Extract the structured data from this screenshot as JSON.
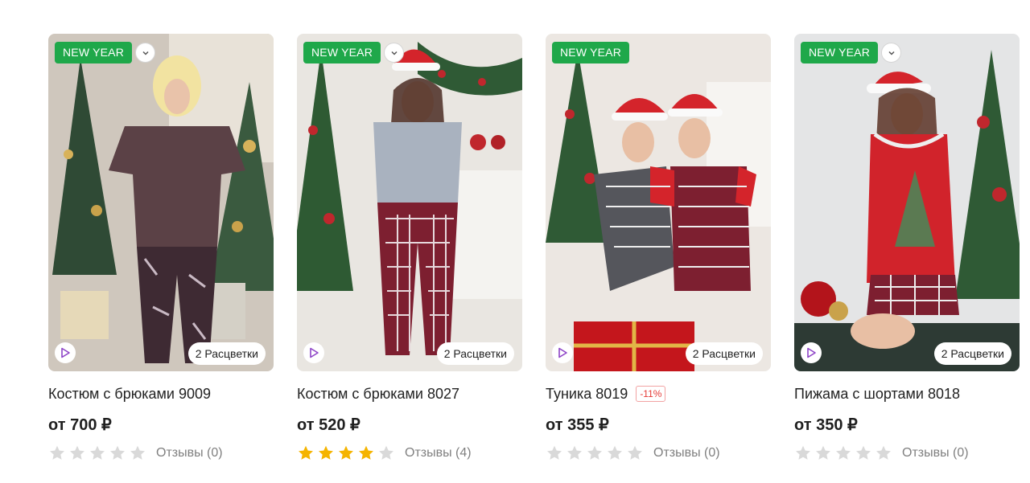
{
  "products": [
    {
      "badge": "NEW YEAR",
      "colors_label": "2 Расцветки",
      "title": "Костюм с брюками 9009",
      "discount": "",
      "price": "от 700 ₽",
      "rating": 0,
      "reviews": "Отзывы (0)"
    },
    {
      "badge": "NEW YEAR",
      "colors_label": "2 Расцветки",
      "title": "Костюм с брюками 8027",
      "discount": "",
      "price": "от 520 ₽",
      "rating": 4,
      "reviews": "Отзывы (4)"
    },
    {
      "badge": "NEW YEAR",
      "colors_label": "2 Расцветки",
      "title": "Туника 8019",
      "discount": "-11%",
      "price": "от 355 ₽",
      "rating": 0,
      "reviews": "Отзывы (0)"
    },
    {
      "badge": "NEW YEAR",
      "colors_label": "2 Расцветки",
      "title": "Пижама с шортами 8018",
      "discount": "",
      "price": "от 350 ₽",
      "rating": 0,
      "reviews": "Отзывы (0)"
    }
  ],
  "icons": {
    "expand": "chevron-down-icon",
    "video": "play-icon",
    "rating": "star-icon"
  },
  "colors": {
    "badge": "#1fa84a",
    "star_filled": "#f5b400",
    "star_empty": "#d9d9d9",
    "play_accent": "#8e44c7",
    "discount": "#e53935"
  }
}
